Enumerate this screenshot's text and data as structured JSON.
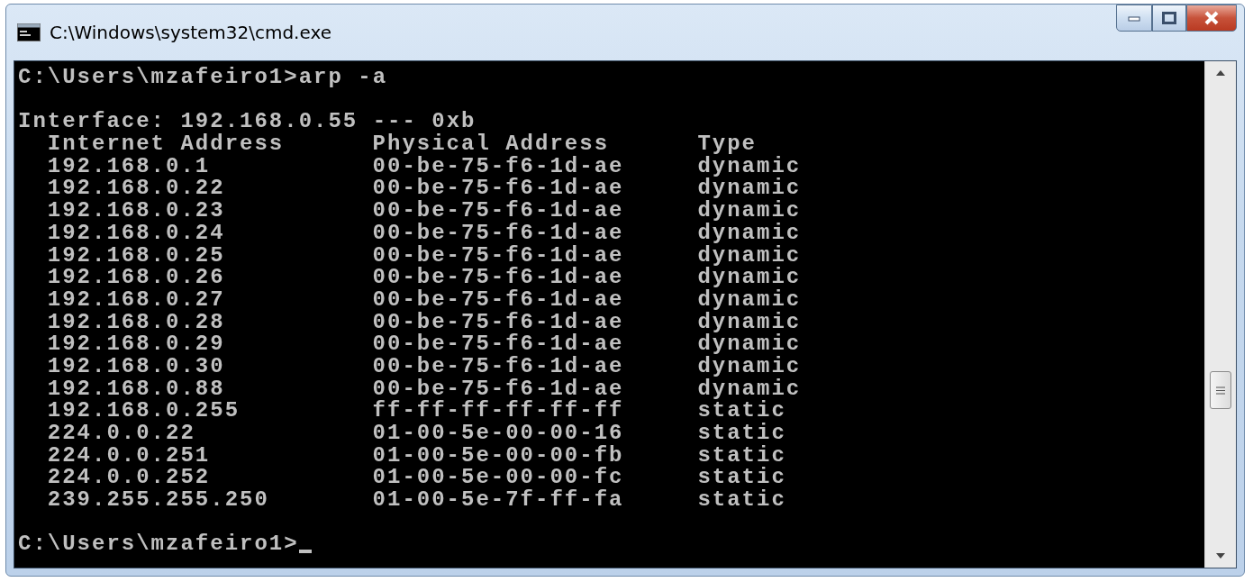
{
  "window": {
    "title": "C:\\Windows\\system32\\cmd.exe"
  },
  "console": {
    "command_prompt": "C:\\Users\\mzafeiro1>",
    "command": "arp -a",
    "interface_line": "Interface: 192.168.0.55 --- 0xb",
    "columns": [
      "Internet Address",
      "Physical Address",
      "Type"
    ],
    "rows": [
      [
        "192.168.0.1",
        "00-be-75-f6-1d-ae",
        "dynamic"
      ],
      [
        "192.168.0.22",
        "00-be-75-f6-1d-ae",
        "dynamic"
      ],
      [
        "192.168.0.23",
        "00-be-75-f6-1d-ae",
        "dynamic"
      ],
      [
        "192.168.0.24",
        "00-be-75-f6-1d-ae",
        "dynamic"
      ],
      [
        "192.168.0.25",
        "00-be-75-f6-1d-ae",
        "dynamic"
      ],
      [
        "192.168.0.26",
        "00-be-75-f6-1d-ae",
        "dynamic"
      ],
      [
        "192.168.0.27",
        "00-be-75-f6-1d-ae",
        "dynamic"
      ],
      [
        "192.168.0.28",
        "00-be-75-f6-1d-ae",
        "dynamic"
      ],
      [
        "192.168.0.29",
        "00-be-75-f6-1d-ae",
        "dynamic"
      ],
      [
        "192.168.0.30",
        "00-be-75-f6-1d-ae",
        "dynamic"
      ],
      [
        "192.168.0.88",
        "00-be-75-f6-1d-ae",
        "dynamic"
      ],
      [
        "192.168.0.255",
        "ff-ff-ff-ff-ff-ff",
        "static"
      ],
      [
        "224.0.0.22",
        "01-00-5e-00-00-16",
        "static"
      ],
      [
        "224.0.0.251",
        "01-00-5e-00-00-fb",
        "static"
      ],
      [
        "224.0.0.252",
        "01-00-5e-00-00-fc",
        "static"
      ],
      [
        "239.255.255.250",
        "01-00-5e-7f-ff-fa",
        "static"
      ]
    ],
    "final_prompt": "C:\\Users\\mzafeiro1>",
    "cursor": true
  }
}
